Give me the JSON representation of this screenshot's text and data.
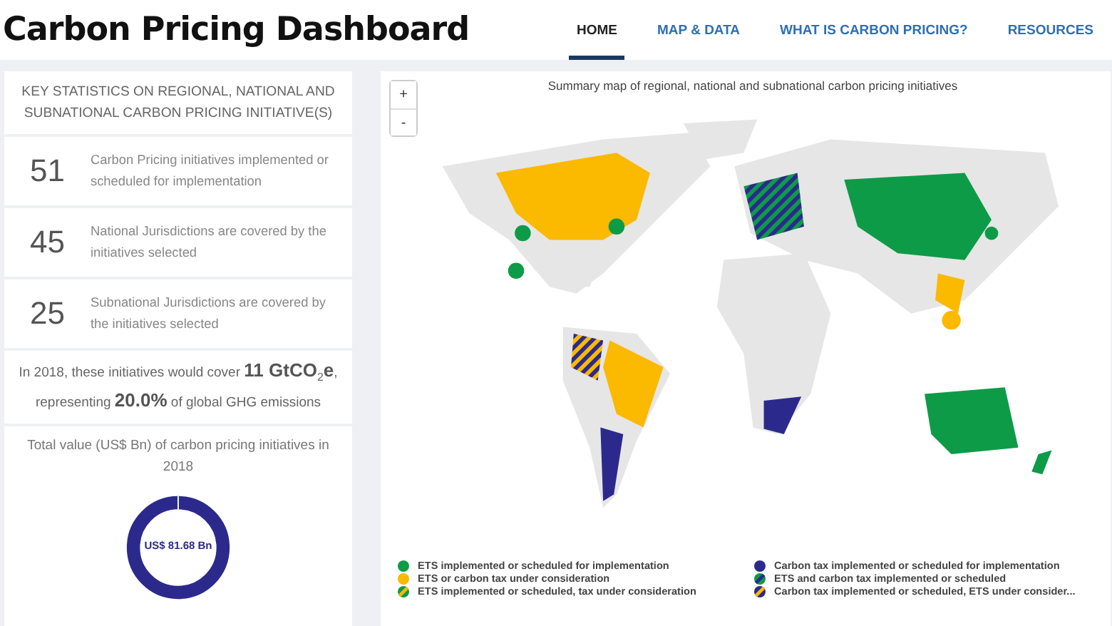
{
  "header": {
    "title": "Carbon Pricing Dashboard"
  },
  "nav": [
    {
      "label": "HOME",
      "selected": true
    },
    {
      "label": "MAP & DATA",
      "selected": false
    },
    {
      "label": "WHAT IS CARBON PRICING?",
      "selected": false
    },
    {
      "label": "RESOURCES",
      "selected": false
    }
  ],
  "stats_panel": {
    "heading": "KEY STATISTICS ON REGIONAL, NATIONAL AND SUBNATIONAL CARBON PRICING INITIATIVE(S)",
    "stats": [
      {
        "number": "51",
        "text": "Carbon Pricing initiatives implemented or scheduled for implementation"
      },
      {
        "number": "45",
        "text": "National Jurisdictions are covered by the initiatives selected"
      },
      {
        "number": "25",
        "text": "Subnational Jurisdictions are covered by the initiatives selected"
      }
    ],
    "coverage": "In 2018, these initiatives would cover **11 GtCO**$_{2}$**e**, representing **20.0%** of global GHG emissions",
    "total_title": "Total value (US$ Bn) of carbon pricing initiatives in 2018",
    "total_value": "US$ 81.68 Bn"
  },
  "map": {
    "title": "Summary map of regional, national and subnational carbon pricing initiatives",
    "zoom_buttons": [
      "+",
      "-"
    ],
    "legend": [
      {
        "kind": "solid",
        "color": "#0d9b48",
        "label": "ETS implemented or scheduled for implementation"
      },
      {
        "kind": "solid",
        "color": "#2b2a8c",
        "label": "Carbon tax implemented or scheduled for implementation"
      },
      {
        "kind": "solid",
        "color": "#fbb900",
        "label": "ETS or carbon tax under consideration"
      },
      {
        "kind": "striped",
        "color": "#0d9b48",
        "stripe": {
          "color": "#2b2a8c"
        },
        "label": "ETS and carbon tax implemented or scheduled"
      },
      {
        "kind": "striped",
        "color": "#0d9b48",
        "stripe": {
          "color": "#fbb900"
        },
        "label": "ETS implemented or scheduled, tax under consideration"
      },
      {
        "kind": "striped",
        "color": "#2b2a8c",
        "stripe": {
          "color": "#fbb900"
        },
        "label": "Carbon tax implemented or scheduled, ETS under consider..."
      }
    ]
  }
}
